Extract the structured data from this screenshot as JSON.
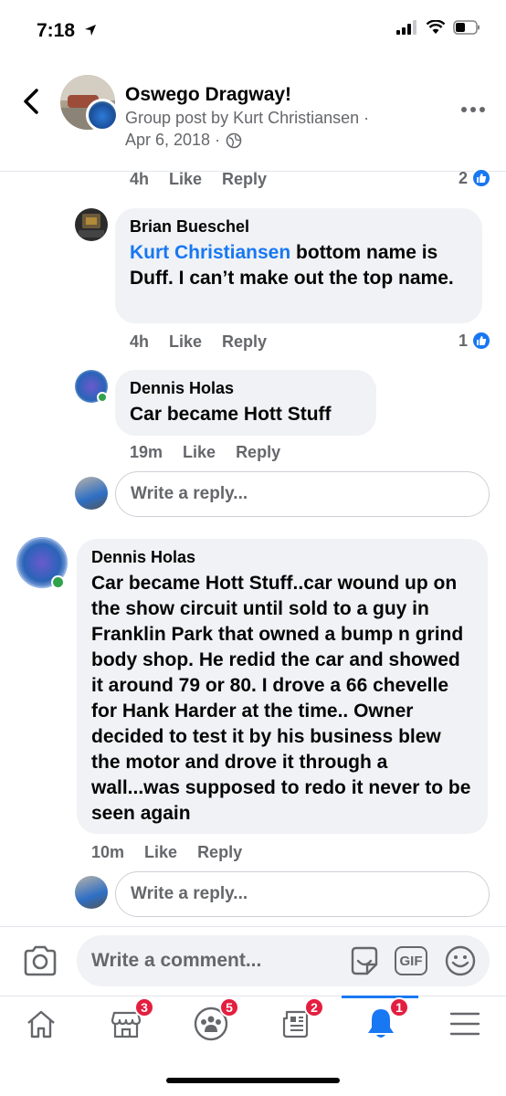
{
  "status_bar": {
    "time": "7:18"
  },
  "header": {
    "title": "Oswego Dragway!",
    "subtitle": "Group post by Kurt Christiansen ·",
    "date": "Apr 6, 2018 ·"
  },
  "comments": [
    {
      "actions": {
        "time": "4h",
        "like": "Like",
        "reply": "Reply"
      },
      "reaction_count": "2"
    },
    {
      "author": "Brian Bueschel",
      "mention": "Kurt Christiansen",
      "text": " bottom name is Duff. I can’t make out the top name.",
      "actions": {
        "time": "4h",
        "like": "Like",
        "reply": "Reply"
      },
      "reaction_count": "1"
    },
    {
      "author": "Dennis Holas",
      "text": "Car became  Hott Stuff",
      "actions": {
        "time": "19m",
        "like": "Like",
        "reply": "Reply"
      }
    },
    {
      "author": "Dennis Holas",
      "text": "Car became  Hott Stuff..car wound up on the show circuit until sold to a guy in Franklin Park that owned a bump n grind body shop. He redid the car and showed it around 79 or 80. I drove a 66 chevelle for Hank Harder at the time.. Owner decided to test it by his business blew the motor and drove it through a wall...was supposed to redo it never to be seen again",
      "actions": {
        "time": "10m",
        "like": "Like",
        "reply": "Reply"
      }
    }
  ],
  "reply_input": {
    "placeholder": "Write a reply..."
  },
  "composer": {
    "placeholder": "Write a comment...",
    "gif_label": "GIF"
  },
  "tabbar": {
    "marketplace_badge": "3",
    "groups_badge": "5",
    "news_badge": "2",
    "notifications_badge": "1"
  },
  "colors": {
    "accent": "#1877f2",
    "badge": "#e41e3f",
    "online": "#31a24c"
  }
}
